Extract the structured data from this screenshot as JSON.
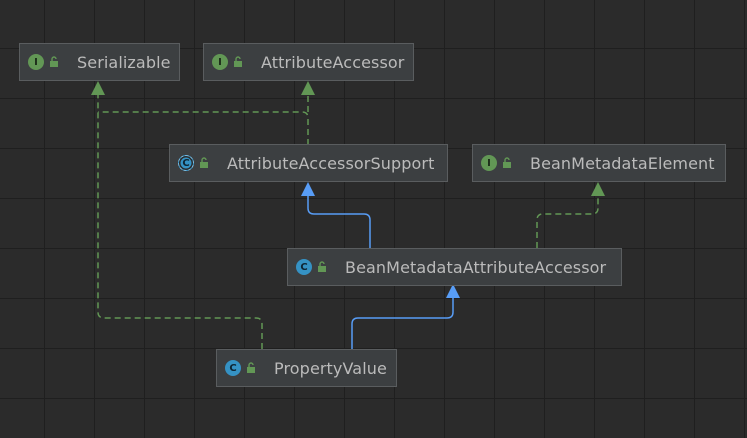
{
  "colors": {
    "background": "#2b2b2b",
    "node_fill": "#3c3f41",
    "node_border": "#5a5d5f",
    "text": "#bbbbbb",
    "implements_edge": "#629755",
    "extends_edge": "#589df6",
    "interface_badge": "#629755",
    "class_badge": "#3592c4"
  },
  "nodes": {
    "serializable": {
      "label": "Serializable",
      "kind": "interface",
      "badge": "I"
    },
    "attribute_accessor": {
      "label": "AttributeAccessor",
      "kind": "interface",
      "badge": "I"
    },
    "attribute_accessor_support": {
      "label": "AttributeAccessorSupport",
      "kind": "abstract-class",
      "badge": "C"
    },
    "bean_metadata_element": {
      "label": "BeanMetadataElement",
      "kind": "interface",
      "badge": "I"
    },
    "bean_metadata_attribute_accessor": {
      "label": "BeanMetadataAttributeAccessor",
      "kind": "class",
      "badge": "C"
    },
    "property_value": {
      "label": "PropertyValue",
      "kind": "class",
      "badge": "C"
    }
  },
  "edges": [
    {
      "from": "PropertyValue",
      "to": "Serializable",
      "relation": "implements"
    },
    {
      "from": "AttributeAccessorSupport",
      "to": "Serializable",
      "relation": "implements"
    },
    {
      "from": "AttributeAccessorSupport",
      "to": "AttributeAccessor",
      "relation": "implements"
    },
    {
      "from": "BeanMetadataAttributeAccessor",
      "to": "AttributeAccessorSupport",
      "relation": "extends"
    },
    {
      "from": "BeanMetadataAttributeAccessor",
      "to": "BeanMetadataElement",
      "relation": "implements"
    },
    {
      "from": "PropertyValue",
      "to": "BeanMetadataAttributeAccessor",
      "relation": "extends"
    }
  ]
}
